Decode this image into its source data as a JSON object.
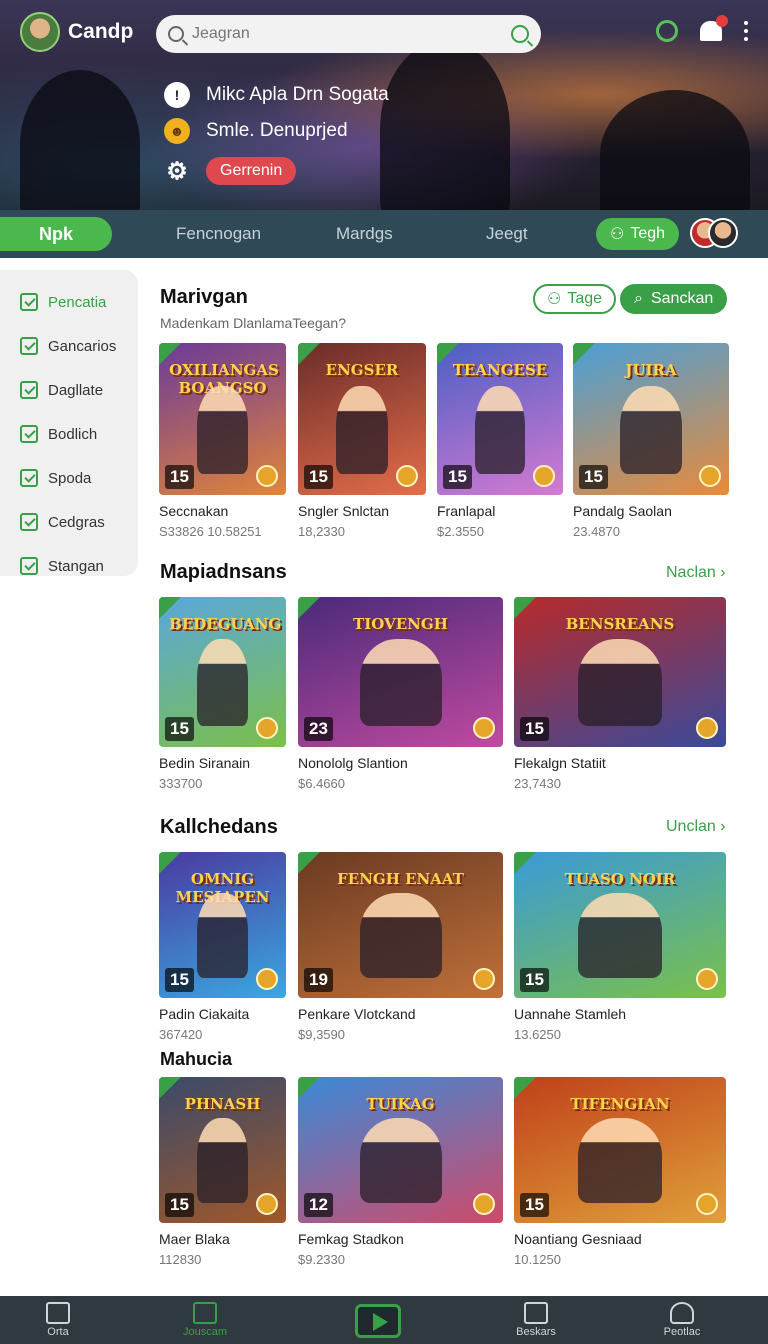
{
  "header": {
    "app_name": "Candp",
    "search_placeholder": "Jeagran",
    "profile": {
      "name": "Mikc Apla Drn Sogata",
      "status": "Smle. Denuprjed",
      "badge": "Gerrenin"
    }
  },
  "tabs": {
    "active": "Npk",
    "items": [
      "Fencnogan",
      "Mardgs",
      "Jeegt"
    ],
    "action": "Tegh"
  },
  "sidebar": {
    "items": [
      {
        "label": "Pencatia",
        "active": true
      },
      {
        "label": "Gancarios",
        "active": false
      },
      {
        "label": "Dagllate",
        "active": false
      },
      {
        "label": "Bodlich",
        "active": false
      },
      {
        "label": "Spoda",
        "active": false
      },
      {
        "label": "Cedgras",
        "active": false
      },
      {
        "label": "Stangan",
        "active": false
      }
    ]
  },
  "featured": {
    "title": "Marivgan",
    "subtitle": "Madenkam DlanlamaTeegan?",
    "tag_button": "Tage",
    "search_button": "Sanckan",
    "cards": [
      {
        "name": "Seccnakan",
        "price": "S33826 10.58251",
        "rating": "15",
        "art_title": "OXILIANGAS BOANGSO",
        "colors": [
          "#6a3a9a",
          "#e2843a"
        ]
      },
      {
        "name": "Sngler Snlctan",
        "price": "18,2330",
        "rating": "15",
        "art_title": "ENGSER",
        "colors": [
          "#6b2c2a",
          "#e46d4a"
        ]
      },
      {
        "name": "Franlapal",
        "price": "$2.3550",
        "rating": "15",
        "art_title": "TEANGESE",
        "colors": [
          "#4b5fc4",
          "#d47ad2"
        ]
      },
      {
        "name": "Pandalg Saolan",
        "price": "23.4870",
        "rating": "15",
        "art_title": "JUIRA",
        "colors": [
          "#4aa0d8",
          "#e88a3a"
        ]
      }
    ]
  },
  "section2": {
    "title": "Mapiadnsans",
    "see_more": "Naclan",
    "cards": [
      {
        "name": "Bedin Siranain",
        "price": "333700",
        "rating": "15",
        "art_title": "BEDEGUANG",
        "colors": [
          "#5aa8dc",
          "#7bbf4a"
        ]
      },
      {
        "name": "Nonololg Slantion",
        "price": "$6.4660",
        "rating": "23",
        "art_title": "TIOVENGH",
        "colors": [
          "#4a2a7a",
          "#c04aa0"
        ]
      },
      {
        "name": "Flekalgn Statiit",
        "price": "23,7430",
        "rating": "15",
        "art_title": "BENSREANS",
        "colors": [
          "#b82a2a",
          "#3a4a9a"
        ]
      }
    ]
  },
  "section3": {
    "title": "Kallchedans",
    "see_more": "Unclan",
    "cards": [
      {
        "name": "Padin Ciakaita",
        "price": "367420",
        "rating": "15",
        "art_title": "OMNIG MESIAPEN",
        "colors": [
          "#4a3aa0",
          "#3aa8e0"
        ]
      },
      {
        "name": "Penkare Vlotckand",
        "price": "$9,3590",
        "rating": "19",
        "art_title": "FENGH ENAAT",
        "colors": [
          "#6a3a22",
          "#c0703a"
        ]
      },
      {
        "name": "Uannahe Stamleh",
        "price": "13.6250",
        "rating": "15",
        "art_title": "TUASO NOIR",
        "colors": [
          "#3a9ad8",
          "#7ac04a"
        ]
      }
    ]
  },
  "section4": {
    "title": "Mahucia",
    "cards": [
      {
        "name": "Maer Blaka",
        "price": "112830",
        "rating": "15",
        "art_title": "PHNASH",
        "colors": [
          "#3a4a6a",
          "#a0582a"
        ]
      },
      {
        "name": "Femkag Stadkon",
        "price": "$9.2330",
        "rating": "12",
        "art_title": "TUIKAG",
        "colors": [
          "#3a8ad8",
          "#d04a6a"
        ]
      },
      {
        "name": "Noantiang Gesniaad",
        "price": "10.1250",
        "rating": "15",
        "art_title": "TIFENGIAN",
        "colors": [
          "#c0401a",
          "#e0a03a"
        ]
      }
    ]
  },
  "bottom_nav": {
    "items": [
      {
        "label": "Orta",
        "icon": "home-icon",
        "active": false
      },
      {
        "label": "Jouscam",
        "icon": "store-icon",
        "active": true
      },
      {
        "label": "Beskars",
        "icon": "inbox-icon",
        "active": false
      },
      {
        "label": "Peotlac",
        "icon": "profile-icon",
        "active": false
      }
    ]
  },
  "colors": {
    "accent": "#3aa048",
    "tabbar": "#2f4a56",
    "bottom_nav": "#2e3a3f",
    "alert": "#e04850"
  }
}
